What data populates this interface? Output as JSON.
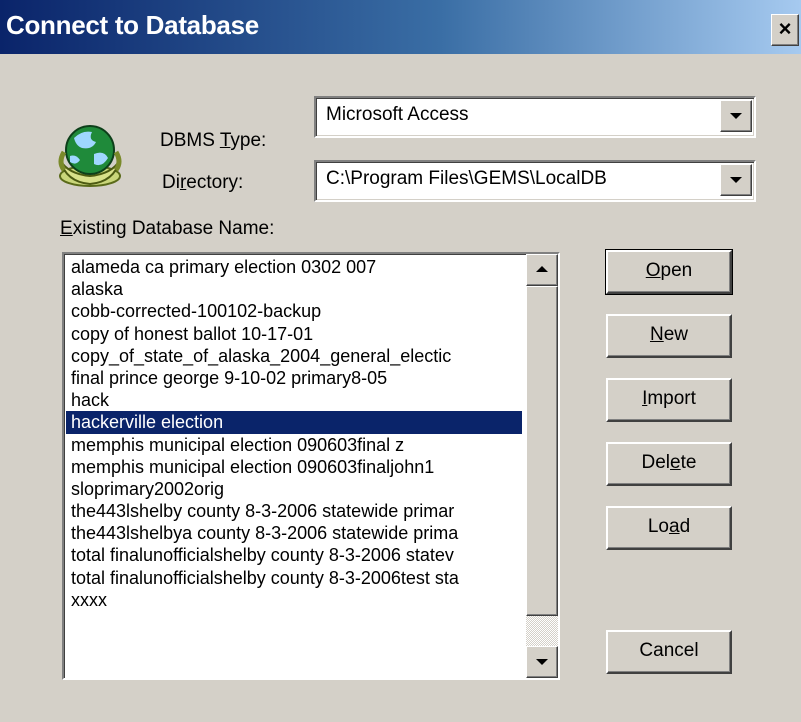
{
  "window": {
    "title": "Connect to Database",
    "close_label": "×"
  },
  "form": {
    "dbms_type_label_pre": "DBMS ",
    "dbms_type_label_u": "T",
    "dbms_type_label_post": "ype:",
    "dbms_type_value": "Microsoft Access",
    "directory_label_pre": "Di",
    "directory_label_u": "r",
    "directory_label_post": "ectory:",
    "directory_value": "C:\\Program Files\\GEMS\\LocalDB",
    "existing_label_u": "E",
    "existing_label_post": "xisting Database Name:"
  },
  "databases": {
    "items": [
      "alameda ca primary election 0302 007",
      "alaska",
      "cobb-corrected-100102-backup",
      "copy of honest ballot 10-17-01",
      "copy_of_state_of_alaska_2004_general_electic",
      "final prince george 9-10-02 primary8-05",
      "hack",
      "hackerville election",
      "memphis municipal election 090603final z",
      "memphis municipal election 090603finaljohn1",
      "sloprimary2002orig",
      "the443lshelby county 8-3-2006 statewide primar",
      "the443lshelbya county 8-3-2006 statewide prima",
      "total finalunofficialshelby county 8-3-2006 statev",
      "total finalunofficialshelby county 8-3-2006test sta",
      "xxxx"
    ],
    "selected": "hackerville election"
  },
  "buttons": {
    "open_u": "O",
    "open_post": "pen",
    "new_u": "N",
    "new_post": "ew",
    "import_u": "I",
    "import_post": "mport",
    "delete_pre": "Del",
    "delete_u": "e",
    "delete_post": "te",
    "load_pre": "Lo",
    "load_u": "a",
    "load_post": "d",
    "cancel": "Cancel"
  },
  "colors": {
    "title_start": "#0a246a",
    "title_end": "#a6caf0",
    "selection": "#0a246a",
    "dialog_bg": "#d4d0c8"
  }
}
